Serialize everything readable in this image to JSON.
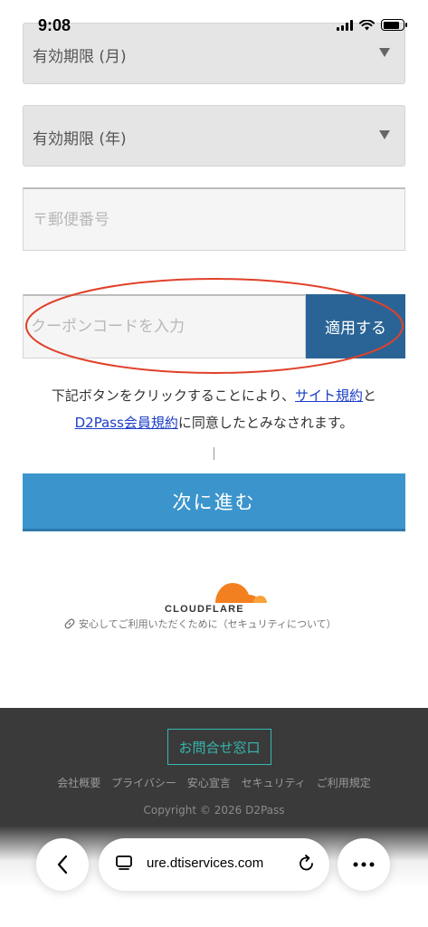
{
  "status_bar": {
    "time": "9:08",
    "battery_level": 0.85
  },
  "form": {
    "expiry_month_label": "有効期限 (月)",
    "expiry_year_label": "有効期限 (年)",
    "postal_code_placeholder": "〒郵便番号",
    "coupon_placeholder": "クーポンコードを入力",
    "apply_button_label": "適用する"
  },
  "agreement": {
    "text_before": "下記ボタンをクリックすることにより、",
    "site_terms_link": "サイト規約",
    "connector": "と",
    "member_terms_link": "D2Pass会員規約",
    "text_after": "に同意したとみなされます。"
  },
  "next_button_label": "次に進む",
  "cloudflare": {
    "brand": "CLOUDFLARE",
    "security_link": "安心してご利用いただくために（セキュリティについて）",
    "brand_color": "#f38020"
  },
  "footer": {
    "contact_button": "お問合せ窓口",
    "links": [
      "会社概要",
      "プライバシー",
      "安心宣言",
      "セキュリティ",
      "ご利用規定"
    ],
    "copyright": "Copyright © 2026 D2Pass"
  },
  "browser": {
    "url": "ure.dtiservices.com"
  },
  "colors": {
    "accent_blue": "#3b95cc",
    "apply_blue": "#2a6496",
    "annotation_red": "#e0412a",
    "footer_accent": "#35b8b0"
  }
}
